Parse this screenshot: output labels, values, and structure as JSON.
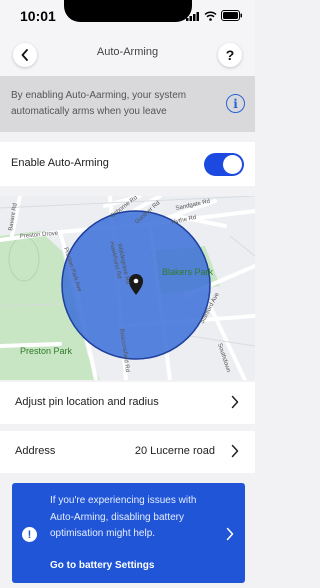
{
  "status_bar": {
    "time": "10:01"
  },
  "header": {
    "title": "Auto-Arming",
    "help_label": "?"
  },
  "info_banner": {
    "text": "By enabling Auto-Aarming, your system automatically arms when you leave",
    "icon_glyph": "i"
  },
  "auto_arming_toggle": {
    "label": "Enable Auto-Arming",
    "enabled": true,
    "active_color": "#1c49e0"
  },
  "map": {
    "streets": [
      "Osborne Rd",
      "Gunther Rd",
      "Sandgate Rd",
      "Hythe Rd",
      "Bavant Rd",
      "Preston Drove",
      "Preston Park Ave",
      "Waldegrave Rd",
      "Hawkhurst Rd",
      "Stanford Ave",
      "Southdown",
      "Beaconsfield Rd"
    ],
    "places": [
      "Blakers Park",
      "Preston Park"
    ],
    "geofence_color": "#3b6fd8"
  },
  "menu": {
    "adjust_label": "Adjust pin location and radius",
    "address_label": "Address",
    "address_value": "20 Lucerne road"
  },
  "battery_card": {
    "message": "If you're experiencing issues with Auto-Arming, disabling battery optimisation might help.",
    "link": "Go to battery Settings",
    "icon_glyph": "!",
    "background": "#1f55d6"
  }
}
